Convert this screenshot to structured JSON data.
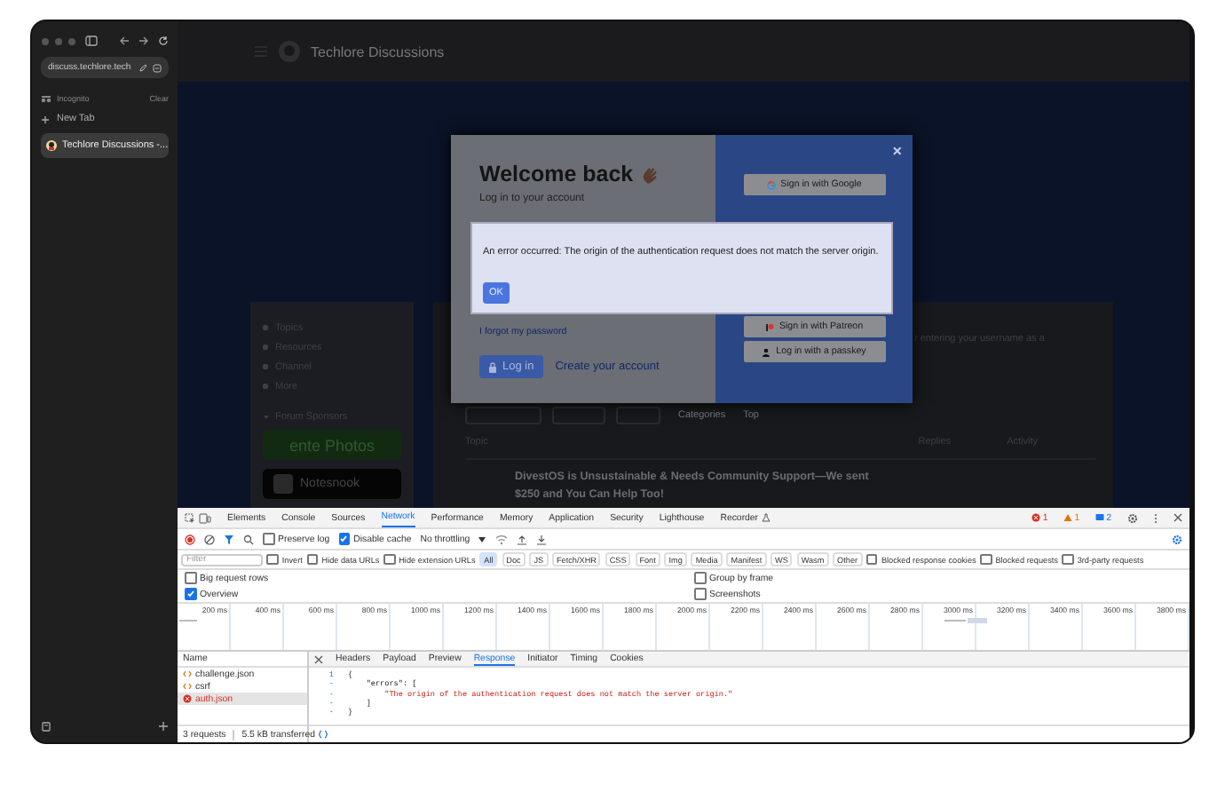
{
  "browser": {
    "address": "discuss.techlore.tech",
    "profile": "Incognito",
    "clear": "Clear",
    "new_tab": "New Tab",
    "tabs": [
      {
        "title": "Techlore Discussions -...",
        "selected": true
      }
    ]
  },
  "page": {
    "site_title": "Techlore Discussions",
    "nav": [
      "Topics",
      "Resources",
      "Channel",
      "More"
    ],
    "sponsors_heading": "Forum Sponsors",
    "sponsors": [
      {
        "kind": "ente",
        "name": "ente Photos"
      },
      {
        "kind": "notesnook",
        "name": "Notesnook"
      }
    ],
    "snippet": "r entering your username as a",
    "filters": [
      "Categories",
      "Top"
    ],
    "columns": [
      "Topic",
      "Replies",
      "Activity"
    ],
    "topic": "DivestOS is Unsustainable & Needs Community Support—We sent $250 and You Can Help Too!"
  },
  "modal": {
    "title": "Welcome back",
    "subtitle": "Log in to your account",
    "forgot": "I forgot my password",
    "login": "Log in",
    "create": "Create your account",
    "close": "×",
    "providers": [
      {
        "kind": "google",
        "label": "Sign in with Google"
      },
      {
        "kind": "patreon",
        "label": "Sign in with Patreon"
      },
      {
        "kind": "passkey",
        "label": "Log in with a passkey"
      }
    ]
  },
  "alert": {
    "message": "An error occurred: The origin of the authentication request does not match the server origin.",
    "button": "OK"
  },
  "devtools": {
    "tabs": [
      {
        "label": "Elements",
        "selected": false
      },
      {
        "label": "Console",
        "selected": false
      },
      {
        "label": "Sources",
        "selected": false
      },
      {
        "label": "Network",
        "selected": true
      },
      {
        "label": "Performance",
        "selected": false
      },
      {
        "label": "Memory",
        "selected": false
      },
      {
        "label": "Application",
        "selected": false
      },
      {
        "label": "Security",
        "selected": false
      },
      {
        "label": "Lighthouse",
        "selected": false
      },
      {
        "label": "Recorder",
        "selected": false
      }
    ],
    "counts": [
      {
        "kind": "error",
        "count": "1"
      },
      {
        "kind": "warning",
        "count": "1"
      },
      {
        "kind": "info",
        "count": "2"
      }
    ],
    "preserve_log": {
      "label": "Preserve log",
      "checked": false
    },
    "disable_cache": {
      "label": "Disable cache",
      "checked": true
    },
    "throttling": "No throttling",
    "filter": {
      "placeholder": "Filter"
    },
    "options": [
      {
        "label": "Invert",
        "checked": false
      },
      {
        "label": "Hide data URLs",
        "checked": false
      },
      {
        "label": "Hide extension URLs",
        "checked": false
      }
    ],
    "types": [
      {
        "label": "All",
        "selected": true
      },
      {
        "label": "Doc",
        "selected": false
      },
      {
        "label": "JS",
        "selected": false
      },
      {
        "label": "Fetch/XHR",
        "selected": false
      },
      {
        "label": "CSS",
        "selected": false
      },
      {
        "label": "Font",
        "selected": false
      },
      {
        "label": "Img",
        "selected": false
      },
      {
        "label": "Media",
        "selected": false
      },
      {
        "label": "Manifest",
        "selected": false
      },
      {
        "label": "WS",
        "selected": false
      },
      {
        "label": "Wasm",
        "selected": false
      },
      {
        "label": "Other",
        "selected": false
      }
    ],
    "blocking": [
      {
        "label": "Blocked response cookies",
        "checked": false
      },
      {
        "label": "Blocked requests",
        "checked": false
      },
      {
        "label": "3rd-party requests",
        "checked": false
      }
    ],
    "settings": [
      {
        "label": "Big request rows",
        "checked": false
      },
      {
        "label": "Group by frame",
        "checked": false
      },
      {
        "label": "Overview",
        "checked": true
      },
      {
        "label": "Screenshots",
        "checked": false
      }
    ],
    "ticks": [
      "200 ms",
      "400 ms",
      "600 ms",
      "800 ms",
      "1000 ms",
      "1200 ms",
      "1400 ms",
      "1600 ms",
      "1800 ms",
      "2000 ms",
      "2200 ms",
      "2400 ms",
      "2600 ms",
      "2800 ms",
      "3000 ms",
      "3200 ms",
      "3400 ms",
      "3600 ms",
      "3800 ms"
    ],
    "requests_header": "Name",
    "requests": [
      {
        "name": "challenge.json",
        "kind": "fetch",
        "selected": false
      },
      {
        "name": "csrf",
        "kind": "fetch",
        "selected": false
      },
      {
        "name": "auth.json",
        "kind": "error",
        "selected": true
      }
    ],
    "summary": [
      "3 requests",
      "5.5 kB transferred"
    ],
    "detail_tabs": [
      {
        "label": "Headers",
        "selected": false
      },
      {
        "label": "Payload",
        "selected": false
      },
      {
        "label": "Preview",
        "selected": false
      },
      {
        "label": "Response",
        "selected": true
      },
      {
        "label": "Initiator",
        "selected": false
      },
      {
        "label": "Timing",
        "selected": false
      },
      {
        "label": "Cookies",
        "selected": false
      }
    ],
    "code": [
      {
        "number": "1",
        "kind": "punct",
        "text": "{"
      },
      {
        "number": "-",
        "kind": "punct",
        "text": "    \"errors\": ["
      },
      {
        "number": "-",
        "kind": "string",
        "text": "        \"The origin of the authentication request does not match the server origin.\""
      },
      {
        "number": "-",
        "kind": "punct",
        "text": "    ]"
      },
      {
        "number": "-",
        "kind": "punct",
        "text": "}"
      }
    ]
  }
}
